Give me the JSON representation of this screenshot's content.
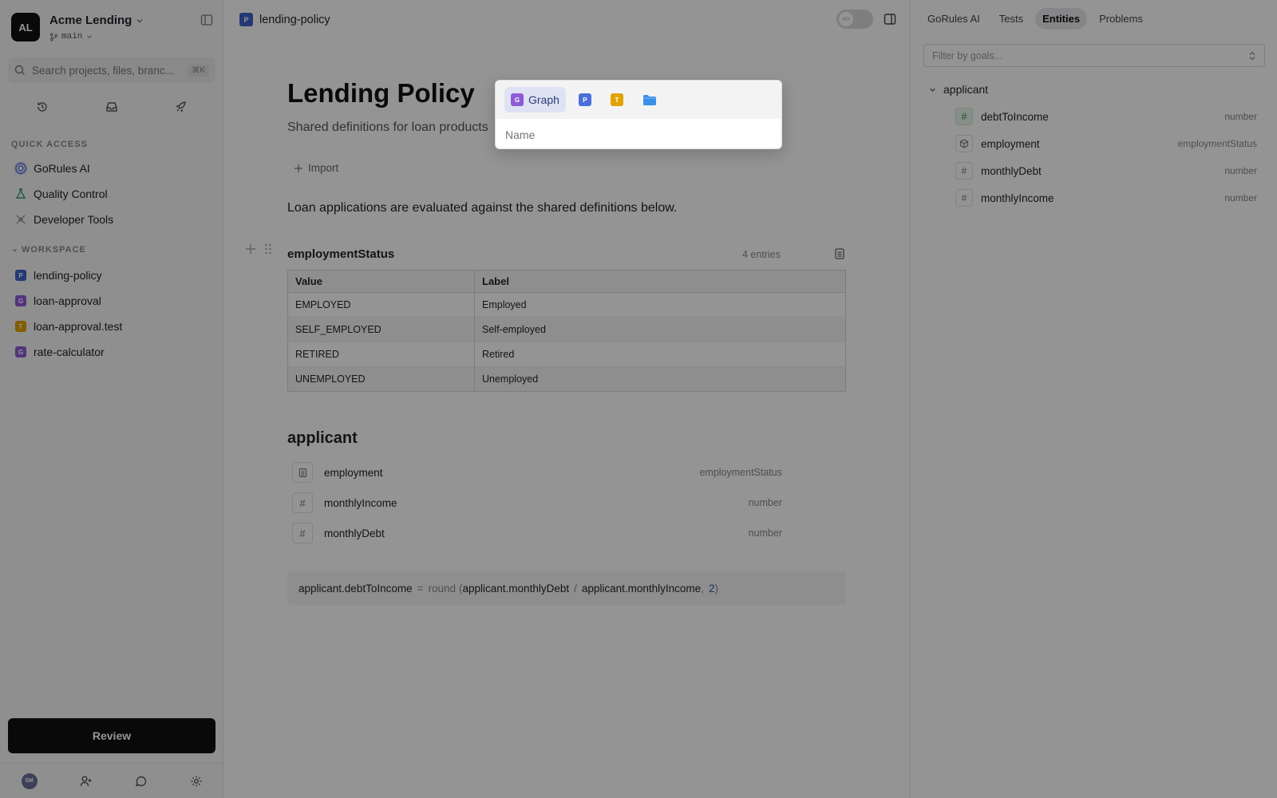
{
  "workspace": {
    "avatar": "AL",
    "name": "Acme Lending",
    "branch": "main"
  },
  "search": {
    "placeholder": "Search projects, files, branc...",
    "shortcut": "⌘K"
  },
  "quick_access": {
    "title": "QUICK ACCESS",
    "items": [
      {
        "label": "GoRules AI",
        "icon": "ai-icon"
      },
      {
        "label": "Quality Control",
        "icon": "flask-icon"
      },
      {
        "label": "Developer Tools",
        "icon": "tools-icon"
      }
    ]
  },
  "workspace_section": {
    "title": "WORKSPACE",
    "items": [
      {
        "label": "lending-policy",
        "badge": "P"
      },
      {
        "label": "loan-approval",
        "badge": "G"
      },
      {
        "label": "loan-approval.test",
        "badge": "T"
      },
      {
        "label": "rate-calculator",
        "badge": "G"
      }
    ]
  },
  "review_label": "Review",
  "footer": {
    "avatar": "SM"
  },
  "editor": {
    "tab_badge": "P",
    "tab_title": "lending-policy",
    "title": "Lending Policy",
    "subtitle": "Shared definitions for loan products",
    "import_label": "Import",
    "paragraph": "Loan applications are evaluated against the shared definitions below.",
    "table": {
      "name": "employmentStatus",
      "count": "4 entries",
      "headers": [
        "Value",
        "Label"
      ],
      "rows": [
        [
          "EMPLOYED",
          "Employed"
        ],
        [
          "SELF_EMPLOYED",
          "Self-employed"
        ],
        [
          "RETIRED",
          "Retired"
        ],
        [
          "UNEMPLOYED",
          "Unemployed"
        ]
      ]
    },
    "entity": {
      "title": "applicant",
      "fields": [
        {
          "name": "employment",
          "type": "employmentStatus",
          "icon": "enum-icon"
        },
        {
          "name": "monthlyIncome",
          "type": "number",
          "icon": "hash-icon"
        },
        {
          "name": "monthlyDebt",
          "type": "number",
          "icon": "hash-icon"
        }
      ]
    },
    "expression": {
      "target": "applicant.debtToIncome",
      "eq": "=",
      "fn": "round",
      "open": "(",
      "arg1": "applicant.monthlyDebt",
      "div": "/",
      "arg2": "applicant.monthlyIncome",
      "comma": ",",
      "num": "2",
      "close": ")"
    }
  },
  "right_panel": {
    "tabs": [
      "GoRules AI",
      "Tests",
      "Entities",
      "Problems"
    ],
    "active_tab": "Entities",
    "filter_placeholder": "Filter by goals...",
    "tree": {
      "root": "applicant",
      "items": [
        {
          "name": "debtToIncome",
          "type": "number",
          "icon": "hash-icon",
          "computed": true
        },
        {
          "name": "employment",
          "type": "employmentStatus",
          "icon": "cube-icon",
          "computed": false
        },
        {
          "name": "monthlyDebt",
          "type": "number",
          "icon": "hash-icon",
          "computed": false
        },
        {
          "name": "monthlyIncome",
          "type": "number",
          "icon": "hash-icon",
          "computed": false
        }
      ]
    }
  },
  "popover": {
    "types": [
      {
        "badge": "G",
        "label": "Graph",
        "color": "#8e5ad6"
      },
      {
        "badge": "P",
        "label": "",
        "color": "#4a6fd8"
      },
      {
        "badge": "T",
        "label": "",
        "color": "#e0a300"
      }
    ],
    "folder_icon": "folder-icon",
    "name_placeholder": "Name"
  }
}
